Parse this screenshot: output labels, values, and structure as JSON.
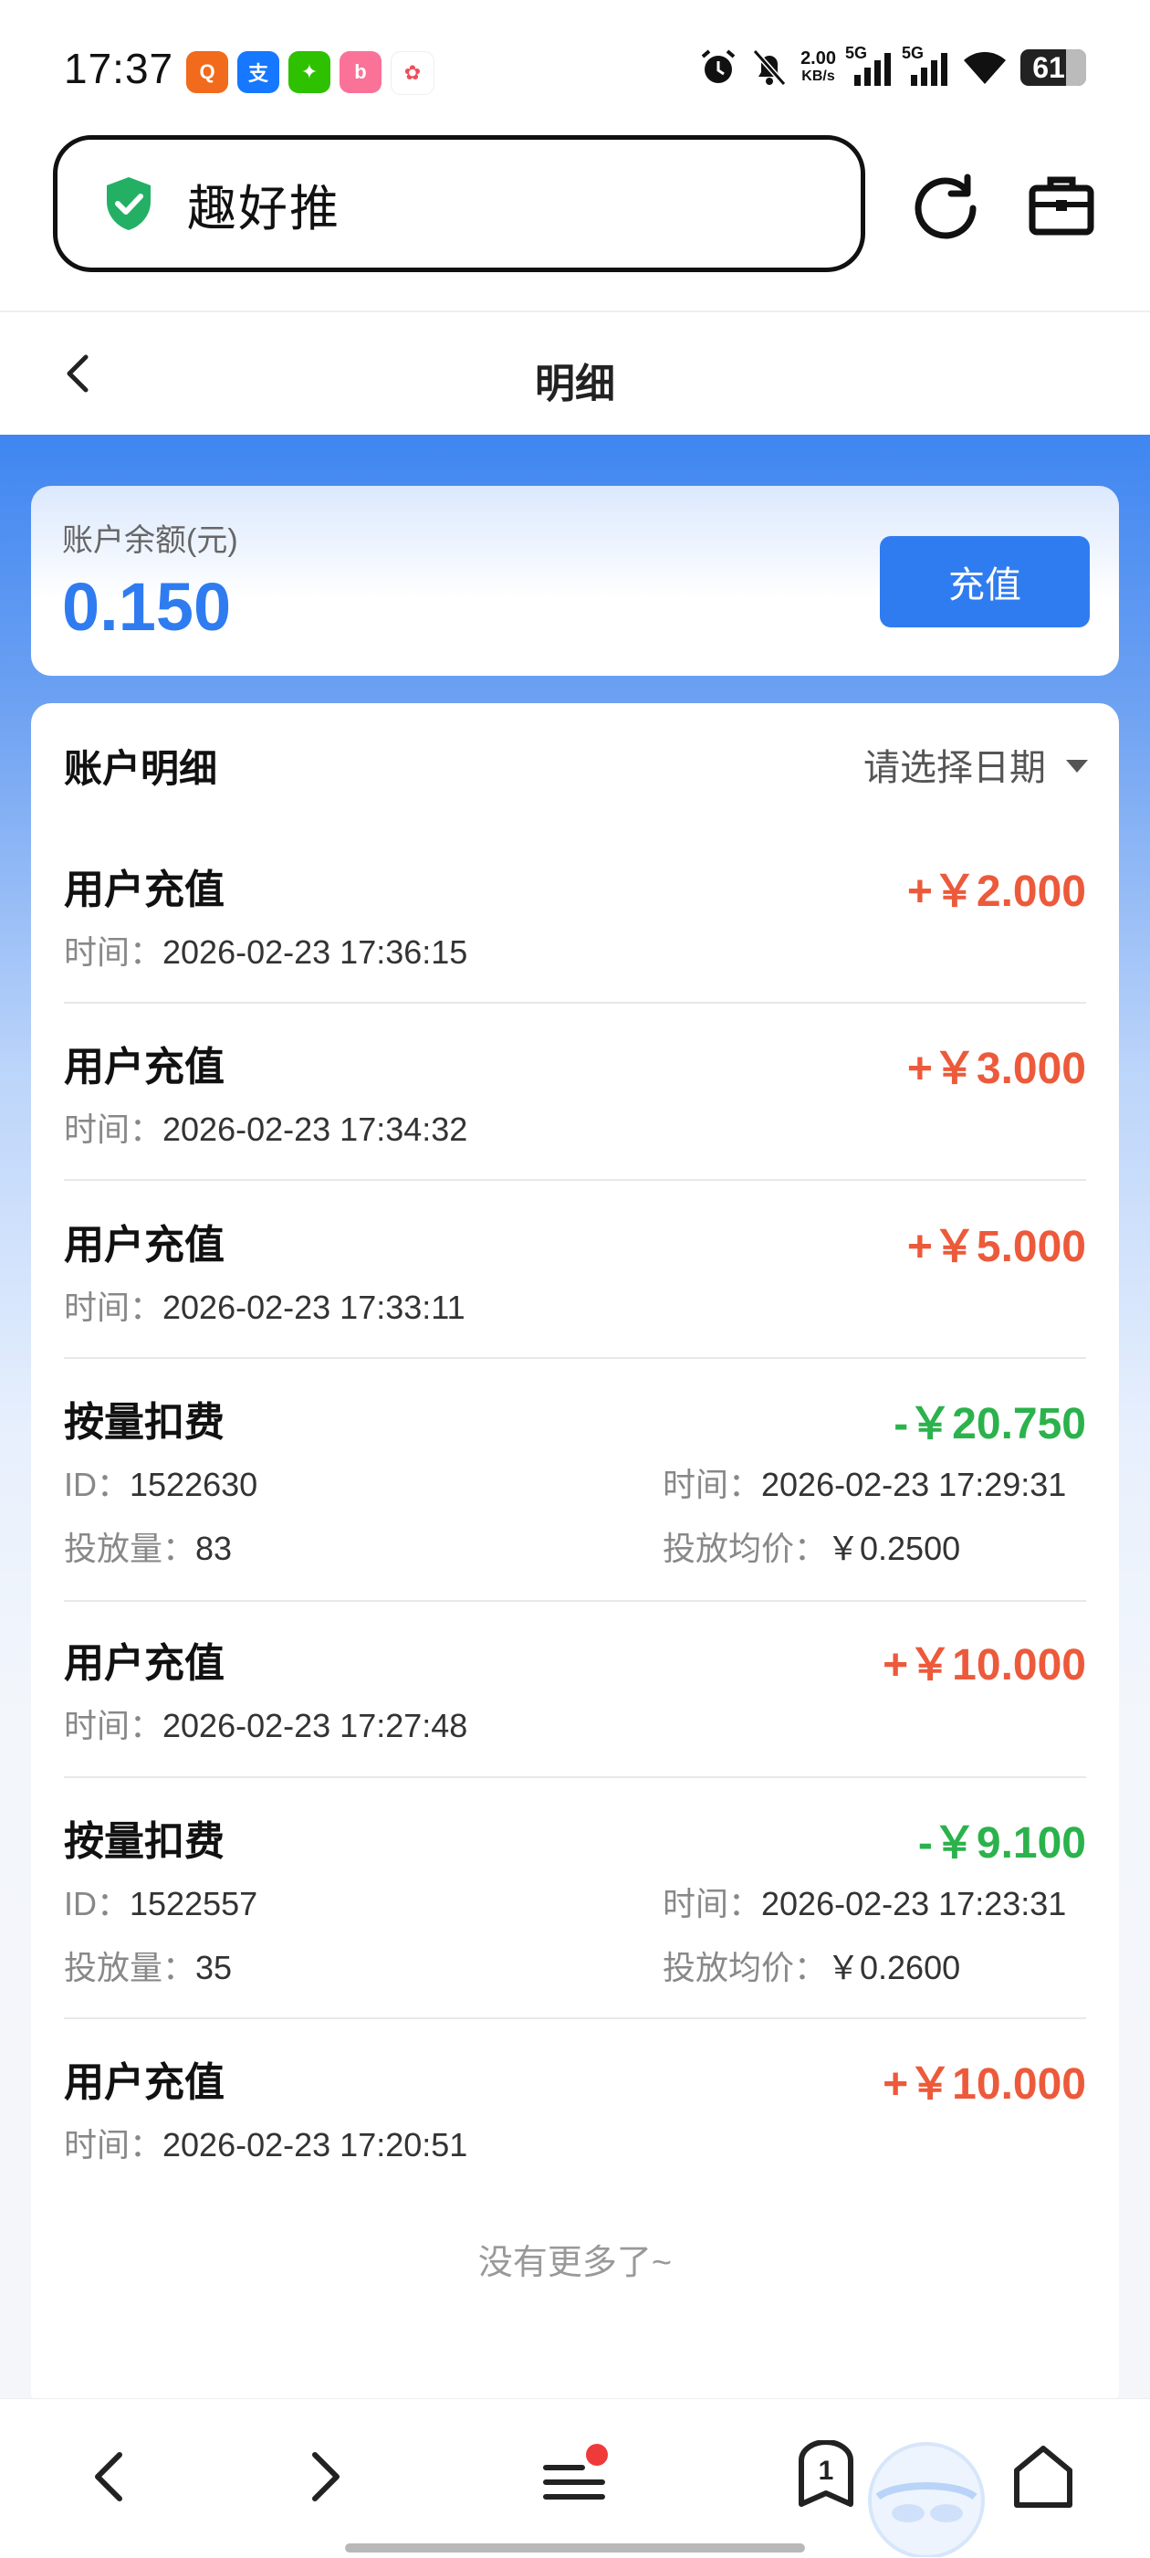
{
  "status_bar": {
    "time": "17:37",
    "network_speed_value": "2.00",
    "network_speed_unit": "KB/s",
    "signal1_label": "5G",
    "signal2_label": "5G",
    "battery": "61",
    "apps": [
      {
        "icon": "app-icon-orange",
        "color": "#f26a1b",
        "glyph": "Q"
      },
      {
        "icon": "alipay-icon",
        "color": "#1677ff",
        "glyph": "支"
      },
      {
        "icon": "wechat-icon",
        "color": "#2dc100",
        "glyph": "✦"
      },
      {
        "icon": "bilibili-icon",
        "color": "#fb7299",
        "glyph": "b"
      },
      {
        "icon": "baidu-icon",
        "color": "#ef4d5b",
        "glyph": "✿"
      }
    ]
  },
  "browser": {
    "url_text": "趣好推",
    "shield_color": "#23b065"
  },
  "header": {
    "title": "明细"
  },
  "balance": {
    "label": "账户余额(元)",
    "value": "0.150",
    "recharge_label": "充值"
  },
  "details": {
    "title": "账户明细",
    "date_placeholder": "请选择日期",
    "records": [
      {
        "type": "recharge",
        "title": "用户充值",
        "amount": "+￥2.000",
        "time_label": "时间：",
        "time": "2026-02-23 17:36:15"
      },
      {
        "type": "recharge",
        "title": "用户充值",
        "amount": "+￥3.000",
        "time_label": "时间：",
        "time": "2026-02-23 17:34:32"
      },
      {
        "type": "recharge",
        "title": "用户充值",
        "amount": "+￥5.000",
        "time_label": "时间：",
        "time": "2026-02-23 17:33:11"
      },
      {
        "type": "deduct",
        "title": "按量扣费",
        "amount": "-￥20.750",
        "id_label": "ID：",
        "id": "1522630",
        "time_label": "时间：",
        "time": "2026-02-23 17:29:31",
        "qty_label": "投放量：",
        "qty": "83",
        "avg_label": "投放均价：",
        "avg": "￥0.2500"
      },
      {
        "type": "recharge",
        "title": "用户充值",
        "amount": "+￥10.000",
        "time_label": "时间：",
        "time": "2026-02-23 17:27:48"
      },
      {
        "type": "deduct",
        "title": "按量扣费",
        "amount": "-￥9.100",
        "id_label": "ID：",
        "id": "1522557",
        "time_label": "时间：",
        "time": "2026-02-23 17:23:31",
        "qty_label": "投放量：",
        "qty": "35",
        "avg_label": "投放均价：",
        "avg": "￥0.2600"
      },
      {
        "type": "recharge",
        "title": "用户充值",
        "amount": "+￥10.000",
        "time_label": "时间：",
        "time": "2026-02-23 17:20:51"
      }
    ],
    "no_more": "没有更多了~"
  },
  "bottom_nav": {
    "tab_count": "1",
    "menu_badge_color": "#f03a3a"
  },
  "colors": {
    "accent": "#2f7cf0",
    "plus": "#ec5a3b",
    "minus": "#2bb24c"
  }
}
